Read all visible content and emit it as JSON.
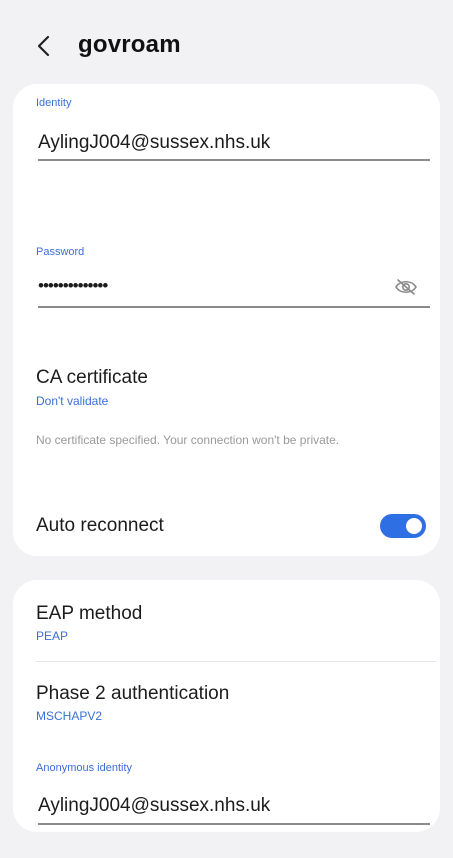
{
  "header": {
    "title": "govroam"
  },
  "identity": {
    "label": "Identity",
    "value": "AylingJ004@sussex.nhs.uk"
  },
  "password": {
    "label": "Password",
    "value": "••••••••••••••"
  },
  "ca_certificate": {
    "title": "CA certificate",
    "value": "Don't validate",
    "hint": "No certificate specified. Your connection won't be private."
  },
  "auto_reconnect": {
    "label": "Auto reconnect",
    "enabled": true
  },
  "eap_method": {
    "title": "EAP method",
    "value": "PEAP"
  },
  "phase2": {
    "title": "Phase 2 authentication",
    "value": "MSCHAPV2"
  },
  "anonymous_identity": {
    "label": "Anonymous identity",
    "value": "AylingJ004@sussex.nhs.uk"
  },
  "colors": {
    "accent": "#2f6fe4",
    "label_blue": "#3a6fd6",
    "background": "#f2f2f4",
    "card": "#ffffff"
  },
  "icons": {
    "back": "chevron-left-icon",
    "password_visibility": "eye-off-icon"
  }
}
